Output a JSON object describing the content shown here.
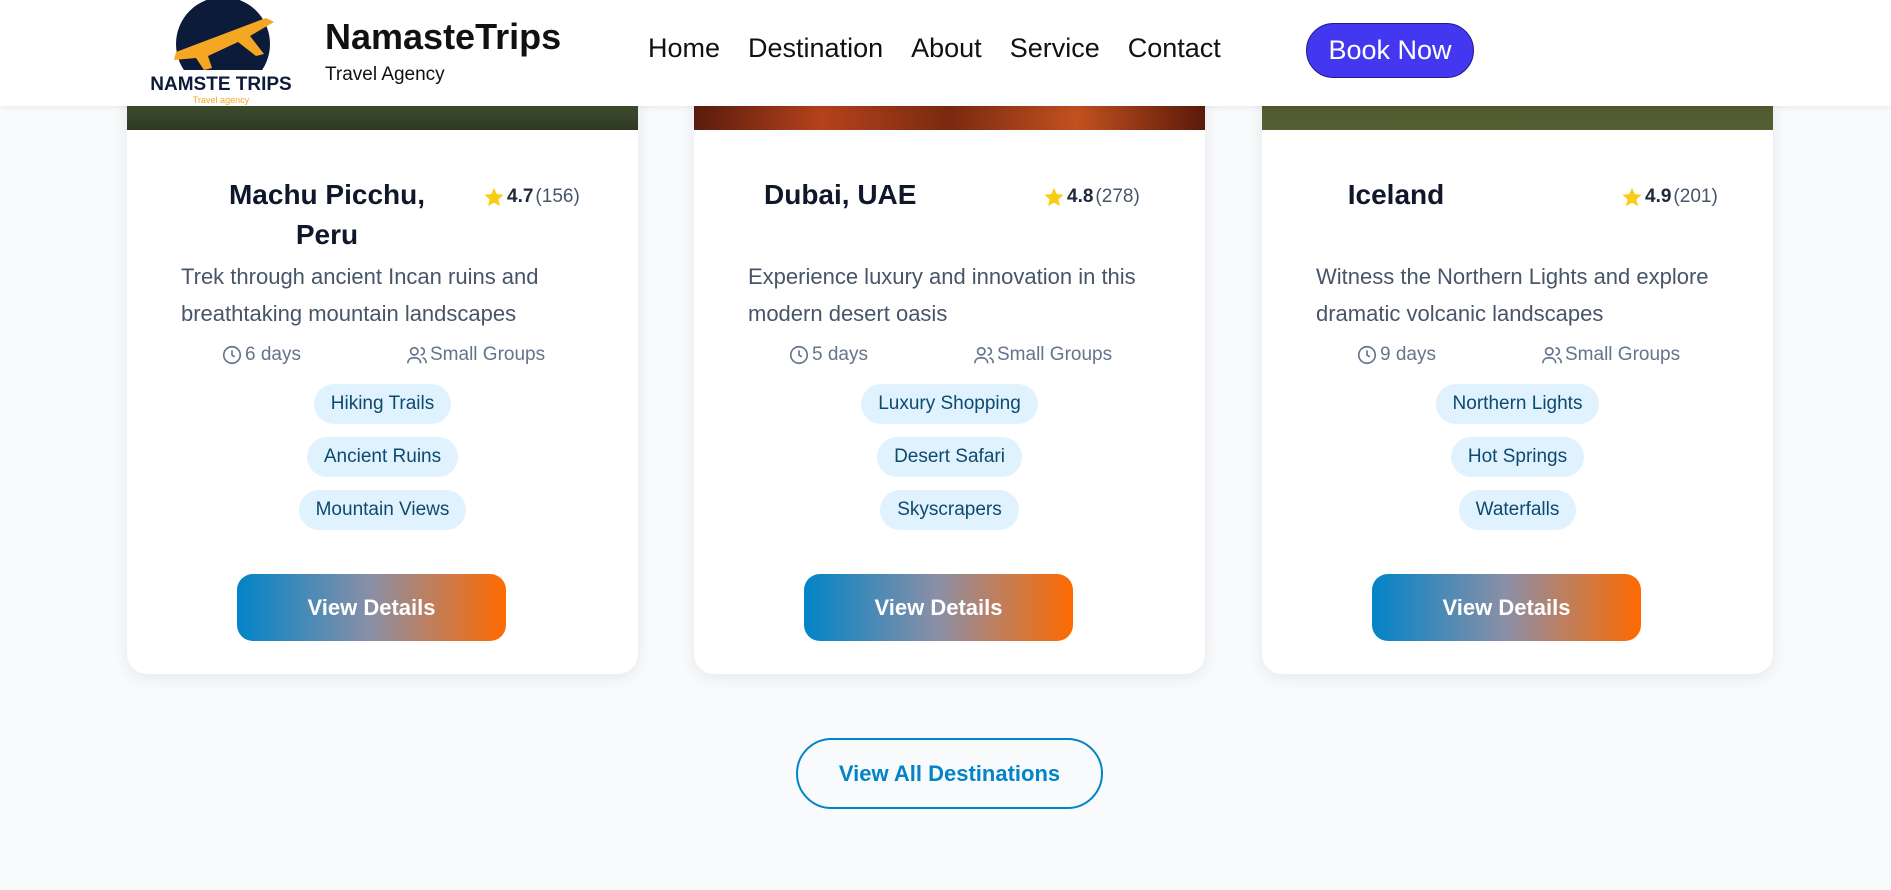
{
  "header": {
    "logo_text": "NAMSTE TRIPS",
    "logo_tagline": "Travel agency",
    "brand_name": "NamasteTrips",
    "brand_subtitle": "Travel Agency",
    "nav": [
      "Home",
      "Destination",
      "About",
      "Service",
      "Contact"
    ],
    "book_label": "Book Now"
  },
  "cards": [
    {
      "title": "Machu Picchu, Peru",
      "rating": "4.7",
      "reviews": "(156)",
      "description": "Trek through ancient Incan ruins and breathtaking mountain landscapes",
      "duration": "6 days",
      "group": "Small Groups",
      "tags": [
        "Hiking Trails",
        "Ancient Ruins",
        "Mountain Views"
      ],
      "button_label": "View Details"
    },
    {
      "title": "Dubai, UAE",
      "rating": "4.8",
      "reviews": "(278)",
      "description": "Experience luxury and innovation in this modern desert oasis",
      "duration": "5 days",
      "group": "Small Groups",
      "tags": [
        "Luxury Shopping",
        "Desert Safari",
        "Skyscrapers"
      ],
      "button_label": "View Details"
    },
    {
      "title": "Iceland",
      "rating": "4.9",
      "reviews": "(201)",
      "description": "Witness the Northern Lights and explore dramatic volcanic landscapes",
      "duration": "9 days",
      "group": "Small Groups",
      "tags": [
        "Northern Lights",
        "Hot Springs",
        "Waterfalls"
      ],
      "button_label": "View Details"
    }
  ],
  "view_all_label": "View All Destinations",
  "colors": {
    "accent_blue": "#0284c7",
    "accent_orange": "#ff6a00",
    "book_button": "#4338ef",
    "star": "#facc15",
    "tag_bg": "#e0f2fe"
  },
  "icons": {
    "star": "star-icon",
    "clock": "clock-icon",
    "users": "users-icon"
  }
}
